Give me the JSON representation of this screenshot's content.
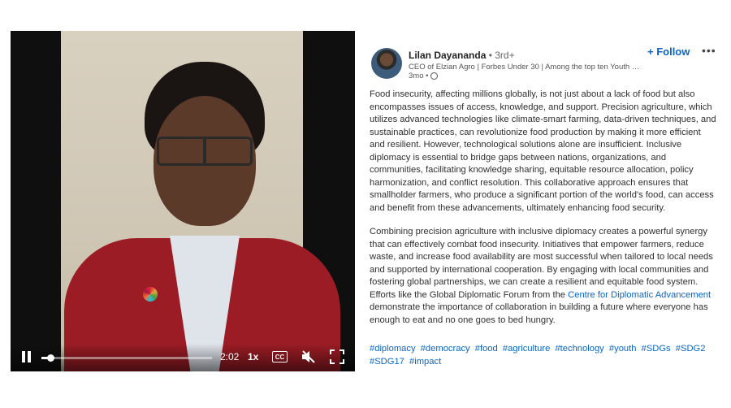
{
  "video": {
    "time": "2:02",
    "speed": "1x",
    "cc_label": "CC",
    "progress": 0.05
  },
  "author": {
    "name": "Lilan Dayananda",
    "degree": " • 3rd+",
    "headline": "CEO of Elzian Agro | Forbes Under 30 | Among the top ten Youth So...",
    "posted": "3mo •"
  },
  "actions": {
    "follow": "+ Follow",
    "more": "•••"
  },
  "post": {
    "paragraph1": "Food insecurity, affecting millions globally, is not just about a lack of food but also encompasses issues of access, knowledge, and support. Precision agriculture, which utilizes advanced technologies like climate-smart farming, data-driven techniques, and sustainable practices, can revolutionize food production by making it more efficient and resilient. However, technological solutions alone are insufficient. Inclusive diplomacy is essential to bridge gaps between nations, organizations, and communities, facilitating knowledge sharing, equitable resource allocation, policy harmonization, and conflict resolution. This collaborative approach ensures that smallholder farmers, who produce a significant portion of the world's food, can access and benefit from these advancements, ultimately enhancing food security.",
    "paragraph2_before_link": "Combining precision agriculture with inclusive diplomacy creates a powerful synergy that can effectively combat food insecurity. Initiatives that empower farmers, reduce waste, and increase food availability are most successful when tailored to local needs and supported by international cooperation. By engaging with local communities and fostering global partnerships, we can create a resilient and equitable food system. Efforts like the Global Diplomatic Forum from the ",
    "link_text": "Centre for Diplomatic Advancement",
    "paragraph2_after_link": " demonstrate the importance of collaboration in building a future where everyone has enough to eat and no one goes to bed hungry."
  },
  "hashtags": [
    "#diplomacy",
    "#democracy",
    "#food",
    "#agriculture",
    "#technology",
    "#youth",
    "#SDGs",
    "#SDG2",
    "#SDG17",
    "#impact"
  ],
  "colors": {
    "link": "#0a66c2",
    "jacket": "#9b1c24"
  }
}
